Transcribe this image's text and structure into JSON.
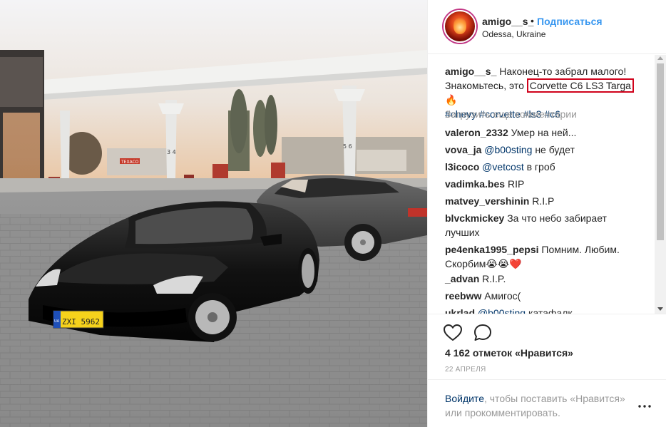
{
  "post": {
    "username": "amigo__s_",
    "separator": "•",
    "follow_label": "Подписаться",
    "location": "Odessa, Ukraine"
  },
  "caption": {
    "username": "amigo__s_",
    "text_before": "Наконец-то забрал малого! Знакомьтесь, это",
    "highlight": "Corvette C6 LS3 Targa",
    "emoji": "🔥",
    "hashtags": [
      "#chevy",
      "#corvette",
      "#ls3",
      "#c6"
    ]
  },
  "load_more_label": "Загрузить еще комментарии",
  "comments": [
    {
      "user": "valeron_2332",
      "mention": "",
      "text": "Умер на ней..."
    },
    {
      "user": "vova_ja",
      "mention": "@b00sting",
      "text": "не будет"
    },
    {
      "user": "l3icoco",
      "mention": "@vetcost",
      "text": "в гроб"
    },
    {
      "user": "vadimka.bes",
      "mention": "",
      "text": "RIP"
    },
    {
      "user": "matvey_vershinin",
      "mention": "",
      "text": "R.I.P"
    },
    {
      "user": "blvckmickey",
      "mention": "",
      "text": "За что небо забирает лучших"
    },
    {
      "user": "pe4enka1995_pepsi",
      "mention": "",
      "text": "Помним. Любим. Скорбим😭😭❤️"
    },
    {
      "user": "_advan",
      "mention": "",
      "text": "R.I.P."
    },
    {
      "user": "reebww",
      "mention": "",
      "text": "Амигос("
    },
    {
      "user": "ukrlad",
      "mention": "@b00sting",
      "text": "катафалк"
    }
  ],
  "likes_text": "4 162 отметок «Нравится»",
  "date": "22 АПРЕЛЯ",
  "login": {
    "link": "Войдите",
    "text": ", чтобы поставить «Нравится» или прокомментировать."
  },
  "photo": {
    "plate_text": "ZXI 5962",
    "plate_country": "UA",
    "pump_numbers_left": "3  4",
    "pump_numbers_right": "5  6",
    "station_sign": "TEXACO"
  },
  "icons": {
    "like": "heart-icon",
    "comment": "speech-bubble-icon",
    "more": "ellipsis-icon"
  },
  "colors": {
    "link_blue": "#3897f0",
    "hashtag": "#003569",
    "highlight_border": "#d0021b",
    "muted": "#999999"
  }
}
